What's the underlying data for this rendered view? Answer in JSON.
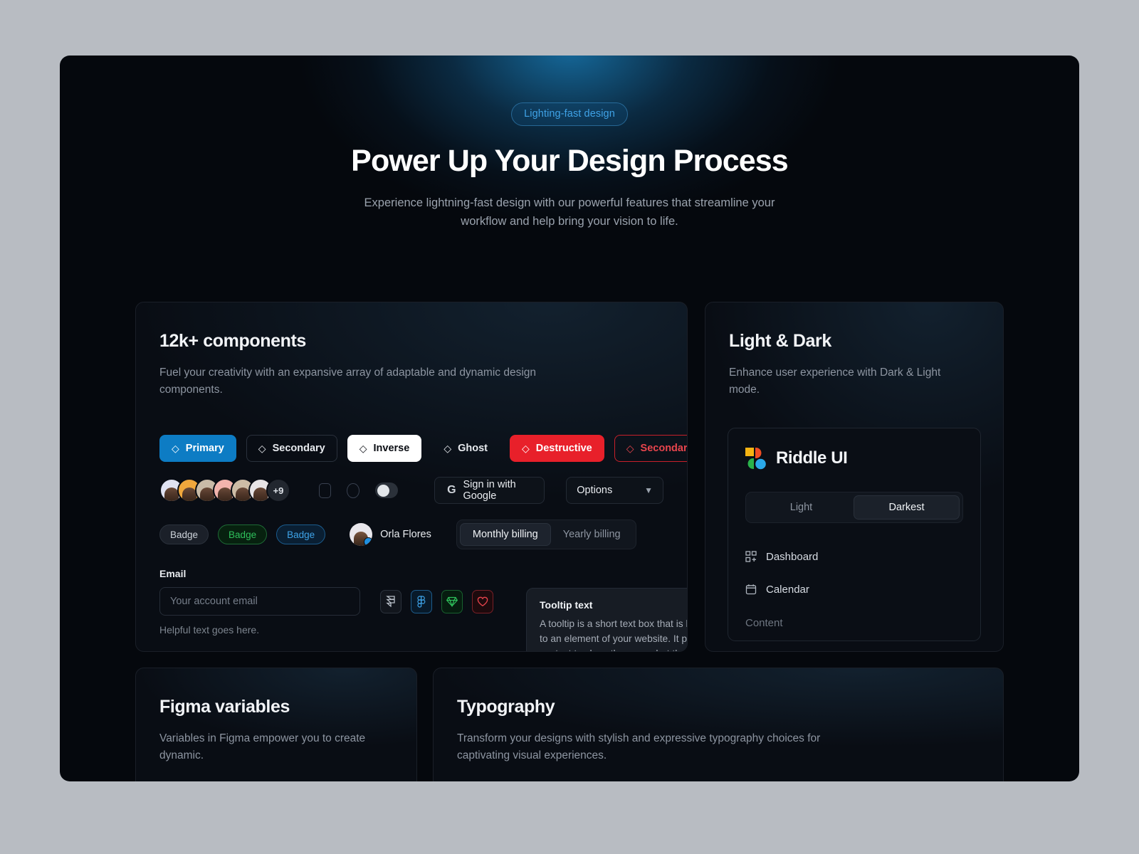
{
  "hero": {
    "pill": "Lighting-fast design",
    "title": "Power Up Your Design Process",
    "subtitle": "Experience lightning-fast design with our powerful features that streamline your workflow and help bring your vision to life."
  },
  "cards": {
    "components": {
      "title": "12k+ components",
      "desc": "Fuel your creativity with an expansive array of adaptable and dynamic design components."
    },
    "lightdark": {
      "title": "Light & Dark",
      "desc": "Enhance user experience with Dark & Light mode."
    },
    "figma": {
      "title": "Figma variables",
      "desc": "Variables in Figma empower you to create dynamic."
    },
    "typography": {
      "title": "Typography",
      "desc": "Transform your designs with stylish and expressive typography choices for captivating visual experiences."
    }
  },
  "buttons": [
    {
      "label": "Primary",
      "icon": "diamond-icon",
      "variant": "primary"
    },
    {
      "label": "Secondary",
      "icon": "diamond-icon",
      "variant": "secondary"
    },
    {
      "label": "Inverse",
      "icon": "diamond-icon",
      "variant": "inverse"
    },
    {
      "label": "Ghost",
      "icon": "diamond-icon",
      "variant": "ghost"
    },
    {
      "label": "Destructive",
      "icon": "diamond-icon",
      "variant": "destructive"
    },
    {
      "label": "Secondary",
      "icon": "diamond-icon",
      "variant": "destructive-secondary"
    }
  ],
  "avatars": {
    "count": 6,
    "overflow": "+9"
  },
  "controls": {
    "checkbox": "checkbox-unchecked",
    "radio": "radio-unchecked",
    "toggle": "toggle-off",
    "google_button": "Sign in with Google",
    "google_icon": "G",
    "select_value": "Options",
    "select_icon": "chevron-down-icon"
  },
  "badges": [
    {
      "label": "Badge",
      "color": "#cdd3da"
    },
    {
      "label": "Badge",
      "color": "#2fc05b"
    },
    {
      "label": "Badge",
      "color": "#3ea3e8"
    }
  ],
  "user": {
    "name": "Orla Flores",
    "badge": "verified-icon"
  },
  "billing": {
    "options": [
      "Monthly billing",
      "Yearly billing"
    ],
    "selected": "Monthly billing"
  },
  "form": {
    "label": "Email",
    "placeholder": "Your account email",
    "value": "",
    "help": "Helpful text goes here."
  },
  "icon_buttons": [
    {
      "name": "framer-icon",
      "color": "#b9c0c9"
    },
    {
      "name": "figma-icon",
      "color": "#3ea3e8"
    },
    {
      "name": "sketch-diamond-icon",
      "color": "#2fc05b"
    },
    {
      "name": "heart-icon",
      "color": "#e8454d"
    }
  ],
  "tooltip": {
    "title": "Tooltip text",
    "body": "A tooltip is a short text box that is linked to an element of your website. It provides context to show the user what that particular element does."
  },
  "preview": {
    "brand": "Riddle UI",
    "logo": "riddle-ui-logo",
    "themes": [
      "Light",
      "Darkest"
    ],
    "selected_theme": "Darkest",
    "nav": [
      {
        "label": "Dashboard",
        "icon": "dashboard-grid-icon"
      },
      {
        "label": "Calendar",
        "icon": "calendar-icon"
      }
    ],
    "content_label": "Content"
  },
  "colors": {
    "accent": "#0d7cc4",
    "danger": "#e8202a",
    "success": "#2fc05b",
    "info": "#3ea3e8",
    "page_bg": "#b8bcc2",
    "canvas_bg": "#05080d"
  }
}
